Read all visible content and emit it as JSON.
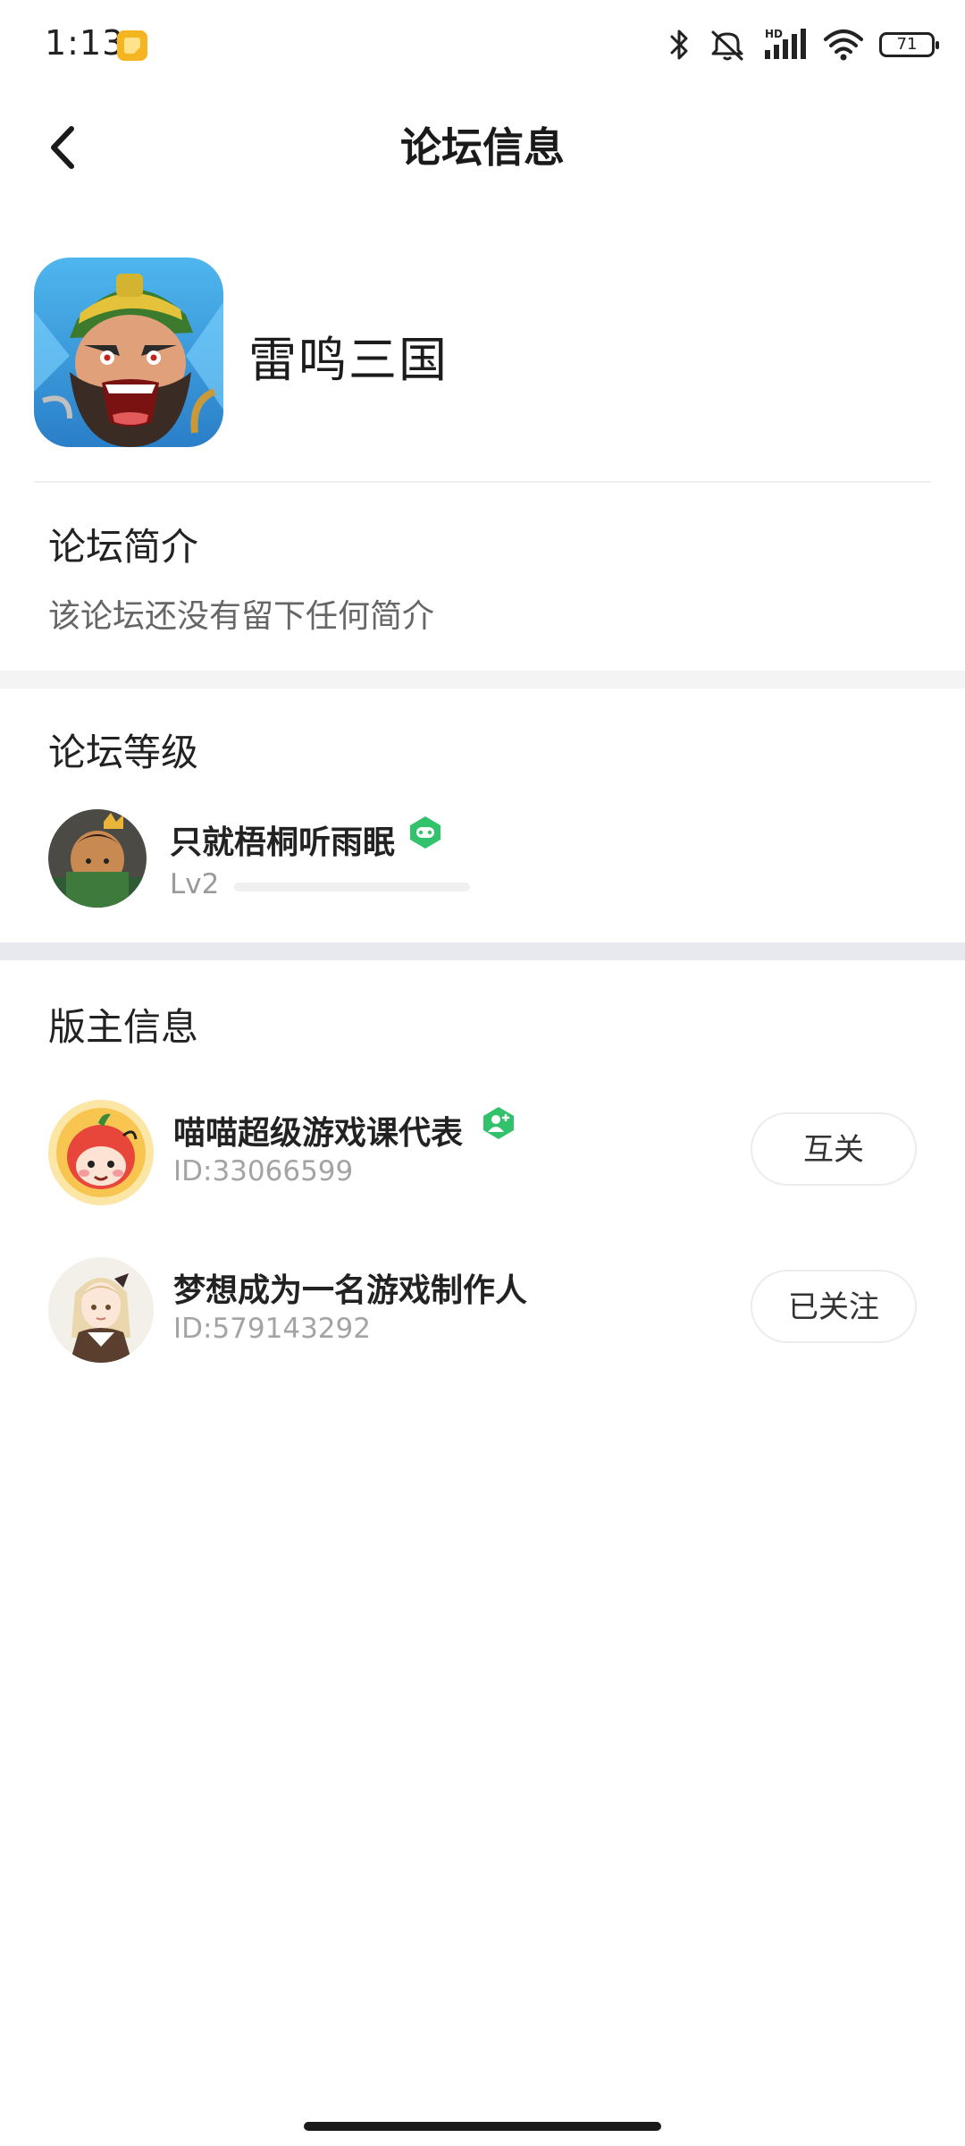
{
  "status_bar": {
    "time": "1:13",
    "battery": "71",
    "icons": [
      "notification-app-icon",
      "bluetooth-icon",
      "mute-icon",
      "hd-signal-icon",
      "wifi-icon",
      "battery-icon"
    ]
  },
  "header": {
    "title": "论坛信息",
    "back_icon": "chevron-left-icon"
  },
  "forum": {
    "name": "雷鸣三国",
    "icon": "game-app-icon"
  },
  "intro": {
    "title": "论坛简介",
    "text": "该论坛还没有留下任何简介"
  },
  "level": {
    "title": "论坛等级",
    "user_name": "只就梧桐听雨眠",
    "level_label": "Lv2",
    "progress": 0.0,
    "badge": "game-badge-icon"
  },
  "moderators": {
    "title": "版主信息",
    "items": [
      {
        "name": "喵喵超级游戏课代表",
        "id_text": "ID:33066599",
        "follow_label": "互关",
        "badge": "moderator-badge-icon"
      },
      {
        "name": "梦想成为一名游戏制作人",
        "id_text": "ID:579143292",
        "follow_label": "已关注"
      }
    ]
  },
  "colors": {
    "accent_green": "#31c26b",
    "section_band": "#f4f4f4",
    "section_band_dark": "#e8e9ee",
    "text_primary": "#222222",
    "text_secondary": "#666666",
    "text_muted": "#a4a4a4"
  }
}
